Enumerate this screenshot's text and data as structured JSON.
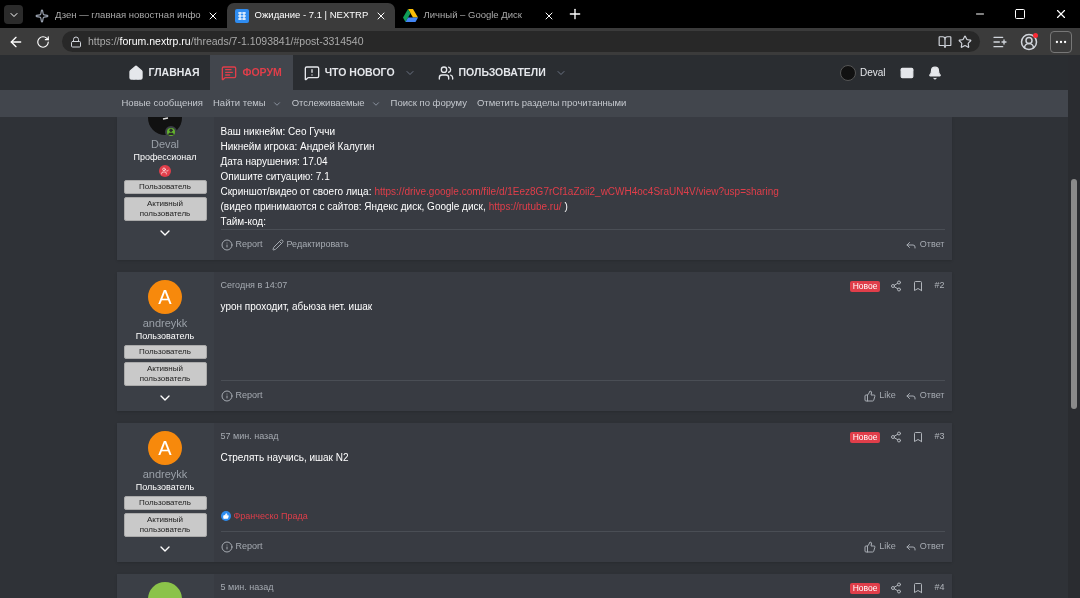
{
  "browser": {
    "tabs": [
      {
        "title": "Дзен — главная новостная инфо",
        "selected": false,
        "kind": "spark"
      },
      {
        "title": "Ожидание - 7.1 | NEXTRP",
        "selected": true,
        "kind": "forum"
      },
      {
        "title": "Личный – Google Диск",
        "selected": false,
        "kind": "drive"
      }
    ],
    "url": {
      "scheme": "https://",
      "host": "forum.nextrp.ru",
      "path": "/threads/7-1.1093841/#post-3314540"
    }
  },
  "nav": {
    "items": [
      {
        "label": "ГЛАВНАЯ",
        "kind": "home",
        "selected": false,
        "dropdown": false
      },
      {
        "label": "ФОРУМ",
        "kind": "forum",
        "selected": true,
        "dropdown": false
      },
      {
        "label": "ЧТО НОВОГО",
        "kind": "news",
        "selected": false,
        "dropdown": true
      },
      {
        "label": "ПОЛЬЗОВАТЕЛИ",
        "kind": "users",
        "selected": false,
        "dropdown": true
      }
    ],
    "user": "Deval"
  },
  "subnav": [
    {
      "label": "Новые сообщения",
      "dropdown": false
    },
    {
      "label": "Найти темы",
      "dropdown": true
    },
    {
      "label": "Отслеживаемые",
      "dropdown": true
    },
    {
      "label": "Поиск по форуму",
      "dropdown": false
    },
    {
      "label": "Отметить разделы прочитанными",
      "dropdown": false
    }
  ],
  "posts": [
    {
      "author": "Deval",
      "avatar": {
        "kind": "image",
        "color": "#111111"
      },
      "online": true,
      "role": "Профессионал",
      "staff_mark": true,
      "banners": [
        "Пользователь",
        "Активный пользователь"
      ],
      "lines": [
        [
          {
            "text": "Ваш никнейм: Сео Гуччи",
            "link": false
          }
        ],
        [
          {
            "text": "Никнейм игрока: Андрей Калугин",
            "link": false
          }
        ],
        [
          {
            "text": "Дата нарушения: 17.04",
            "link": false
          }
        ],
        [
          {
            "text": "Опишите ситуацию: 7.1",
            "link": false
          }
        ],
        [
          {
            "text": "Скриншот/видео от своего лица:",
            "link": false
          },
          {
            "text": "https://drive.google.com/file/d/1Eez8G7rCf1aZoii2_wCWH4oc4SraUN4V/view?usp=sharing",
            "link": true
          }
        ],
        [
          {
            "text": "(видео принимаются с сайтов: Яндекс диск, Google диск,",
            "link": false
          },
          {
            "text": "https://rutube.ru/",
            "link": true
          },
          {
            "text": ")",
            "link": false
          }
        ],
        [
          {
            "text": "Тайм-код:",
            "link": false
          }
        ]
      ],
      "actions": [
        {
          "kind": "report",
          "label": "Report"
        },
        {
          "kind": "edit",
          "label": "Редактировать"
        }
      ],
      "right_actions": [
        {
          "kind": "reply",
          "label": "Ответ"
        }
      ]
    },
    {
      "author": "andreykk",
      "avatar": {
        "kind": "letter",
        "letter": "A",
        "color": "#f7890c"
      },
      "online": false,
      "role": "Пользователь",
      "staff_mark": false,
      "banners": [
        "Пользователь",
        "Активный пользователь"
      ],
      "date": "Сегодня в 14:07",
      "new_badge": "Новое",
      "number": "#2",
      "lines": [
        [
          {
            "text": "урон проходит, абьюза нет. ишак",
            "link": false
          }
        ]
      ],
      "actions": [
        {
          "kind": "report",
          "label": "Report"
        }
      ],
      "right_actions": [
        {
          "kind": "like",
          "label": "Like"
        },
        {
          "kind": "reply",
          "label": "Ответ"
        }
      ]
    },
    {
      "author": "andreykk",
      "avatar": {
        "kind": "letter",
        "letter": "A",
        "color": "#f7890c"
      },
      "online": false,
      "role": "Пользователь",
      "staff_mark": false,
      "banners": [
        "Пользователь",
        "Активный пользователь"
      ],
      "date": "57 мин. назад",
      "new_badge": "Новое",
      "number": "#3",
      "lines": [
        [
          {
            "text": "Стрелять научись, ишак N2",
            "link": false
          }
        ]
      ],
      "reaction": "Франческо Прада",
      "actions": [
        {
          "kind": "report",
          "label": "Report"
        }
      ],
      "right_actions": [
        {
          "kind": "like",
          "label": "Like"
        },
        {
          "kind": "reply",
          "label": "Ответ"
        }
      ]
    },
    {
      "avatar": {
        "kind": "letter",
        "color": "#8bc34a"
      },
      "online": false,
      "staff_mark": false,
      "date": "5 мин. назад",
      "new_badge": "Новое",
      "number": "#4"
    }
  ]
}
